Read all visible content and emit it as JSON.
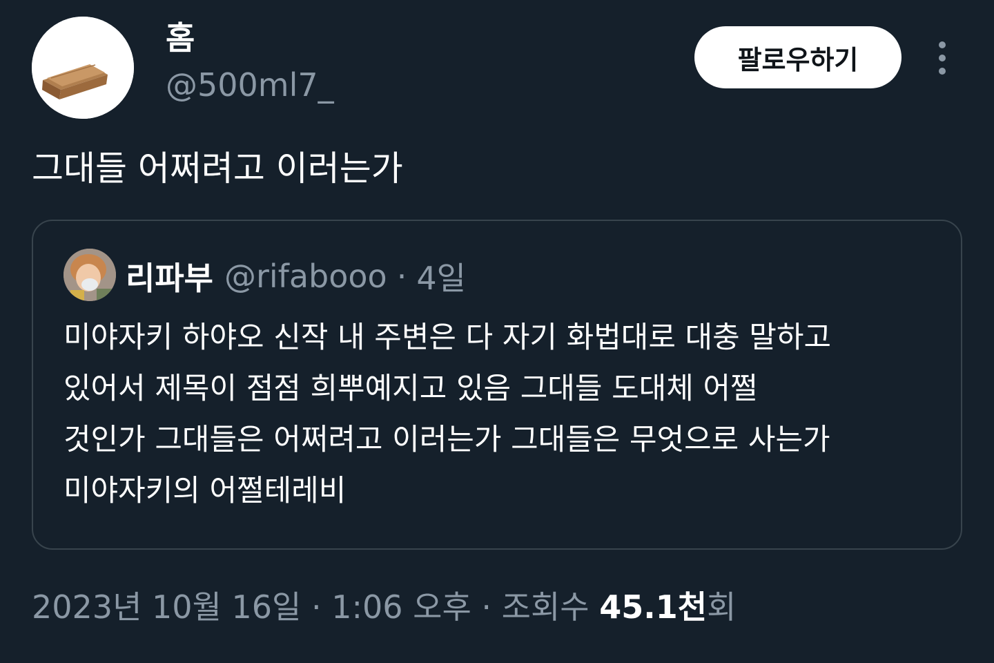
{
  "author": {
    "display_name": "홈",
    "handle": "@500ml7_",
    "avatar_icon": "coffin-icon"
  },
  "actions": {
    "follow_label": "팔로우하기",
    "more_icon": "more-vertical-icon"
  },
  "tweet": {
    "text": "그대들 어쩌려고 이러는가"
  },
  "quote": {
    "display_name": "리파부",
    "handle": "@rifabooo",
    "separator": "·",
    "time": "4일",
    "avatar_icon": "child-with-mask-avatar",
    "lines": [
      "미야자키 하야오 신작 내 주변은 다 자기 화법대로 대충 말하고",
      "있어서 제목이 점점 희뿌예지고 있음 그대들 도대체 어쩔",
      "것인가 그대들은 어쩌려고 이러는가 그대들은 무엇으로 사는가",
      "미야자키의 어쩔테레비"
    ]
  },
  "meta": {
    "date": "2023년 10월 16일",
    "sep1": " · ",
    "time": "1:06 오후",
    "sep2": " · ",
    "views_label": "조회수 ",
    "views_count": "45.1천",
    "views_suffix": "회"
  },
  "colors": {
    "background": "#15202b",
    "text_primary": "#ffffff",
    "text_secondary": "#8b98a5",
    "border": "#38444d",
    "button_bg": "#ffffff",
    "button_text": "#0f1419"
  }
}
